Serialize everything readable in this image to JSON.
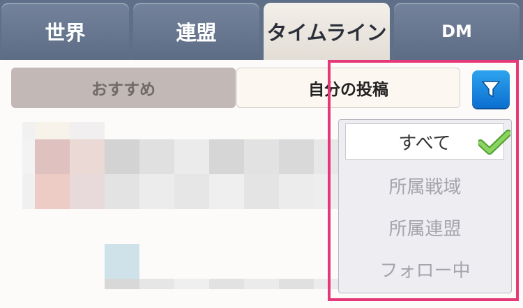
{
  "tabs": [
    {
      "label": "世界"
    },
    {
      "label": "連盟"
    },
    {
      "label": "タイムライン"
    },
    {
      "label": "DM"
    }
  ],
  "subtabs": {
    "recommended": "おすすめ",
    "my_posts": "自分の投稿"
  },
  "filter_menu": {
    "options": [
      {
        "label": "すべて",
        "selected": true
      },
      {
        "label": "所属戦域",
        "selected": false
      },
      {
        "label": "所属連盟",
        "selected": false
      },
      {
        "label": "フォロー中",
        "selected": false
      }
    ]
  },
  "colors": {
    "active_tab": "#eae6e0",
    "inactive_tab": "#66758e",
    "filter_button": "#1b8ce4",
    "check": "#6cc04a",
    "highlight": "#e53878"
  },
  "icons": {
    "filter": "funnel-icon",
    "selected": "checkmark-icon"
  }
}
